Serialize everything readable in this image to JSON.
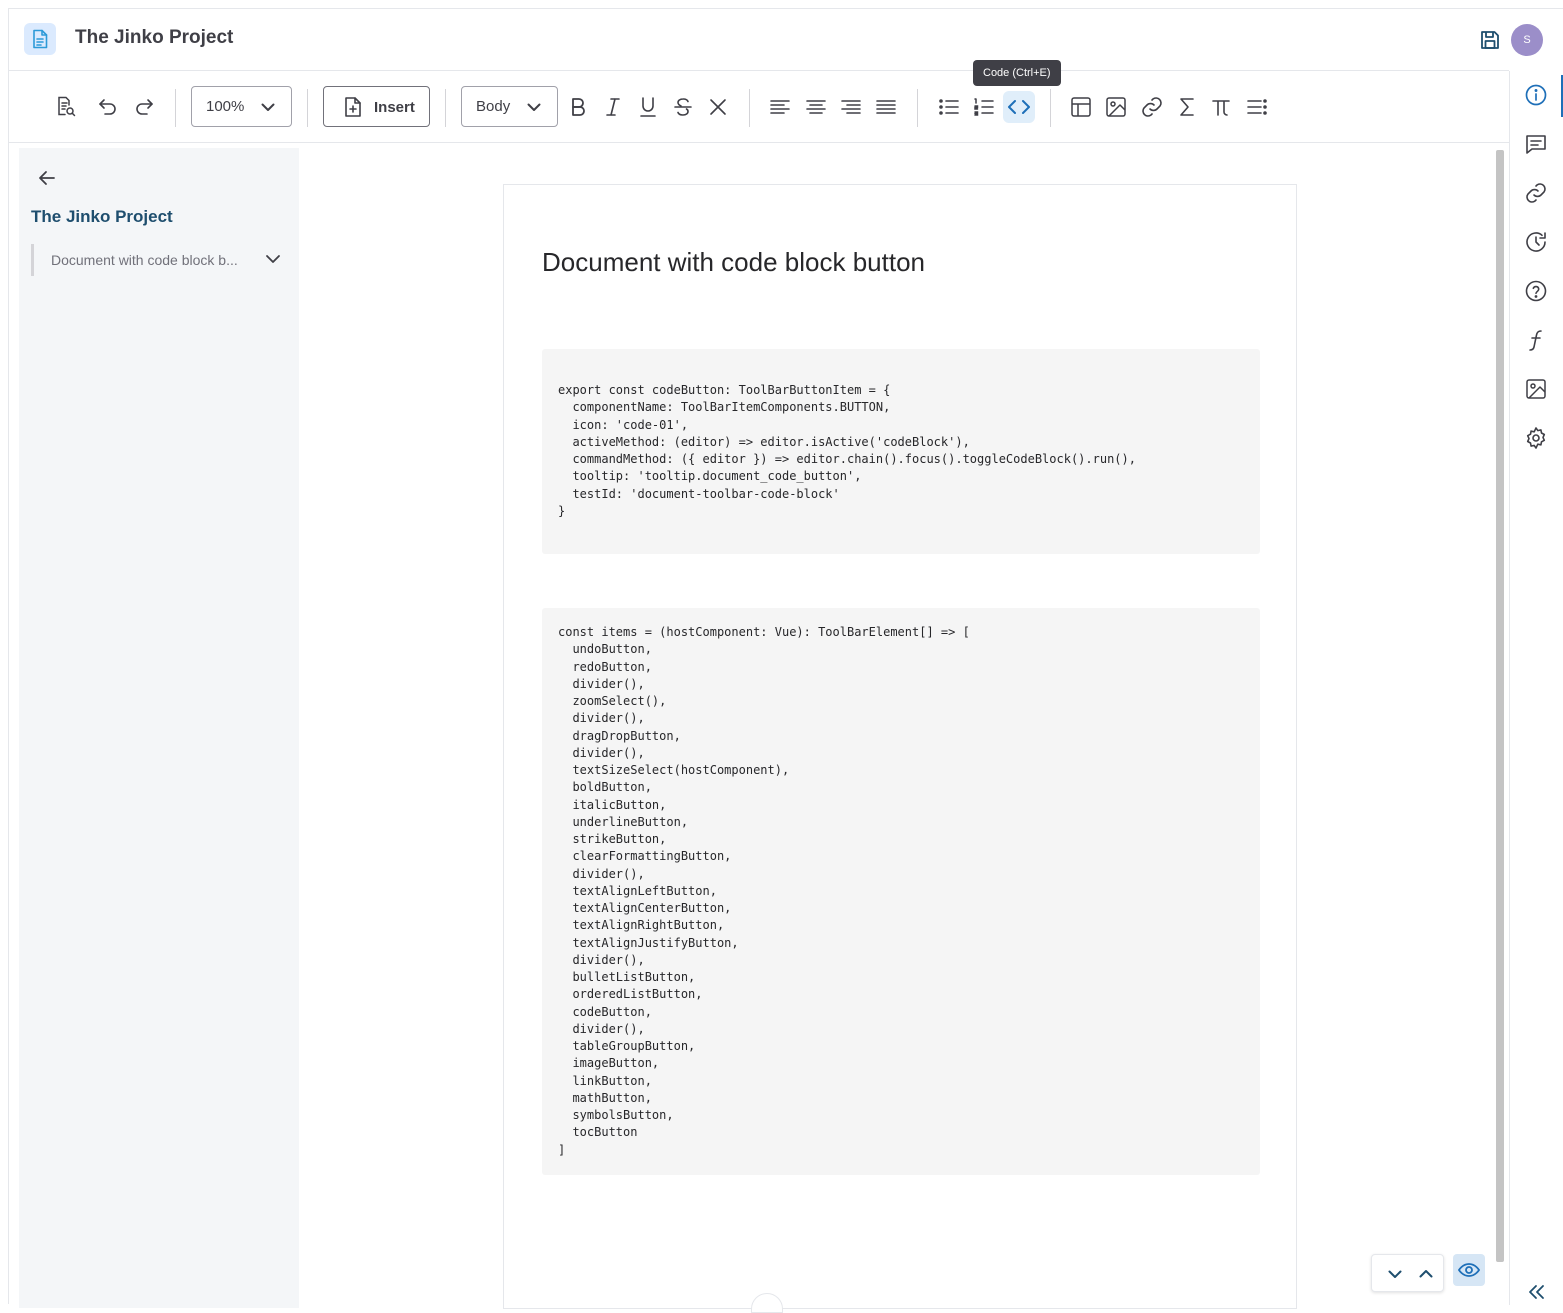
{
  "header": {
    "app_title": "The Jinko Project",
    "avatar_initial": "S"
  },
  "toolbar": {
    "zoom_value": "100%",
    "insert_label": "Insert",
    "text_style_value": "Body",
    "tooltip": "Code (Ctrl+E)",
    "active_button": "code-button"
  },
  "left_panel": {
    "title": "The Jinko Project",
    "doc_item_label": "Document with code block b..."
  },
  "document": {
    "title": "Document with code block button",
    "code_blocks": [
      "export const codeButton: ToolBarButtonItem = {\n  componentName: ToolBarItemComponents.BUTTON,\n  icon: 'code-01',\n  activeMethod: (editor) => editor.isActive('codeBlock'),\n  commandMethod: ({ editor }) => editor.chain().focus().toggleCodeBlock().run(),\n  tooltip: 'tooltip.document_code_button',\n  testId: 'document-toolbar-code-block'\n}",
      "const items = (hostComponent: Vue): ToolBarElement[] => [\n  undoButton,\n  redoButton,\n  divider(),\n  zoomSelect(),\n  divider(),\n  dragDropButton,\n  divider(),\n  textSizeSelect(hostComponent),\n  boldButton,\n  italicButton,\n  underlineButton,\n  strikeButton,\n  clearFormattingButton,\n  divider(),\n  textAlignLeftButton,\n  textAlignCenterButton,\n  textAlignRightButton,\n  textAlignJustifyButton,\n  divider(),\n  bulletListButton,\n  orderedListButton,\n  codeButton,\n  divider(),\n  tableGroupButton,\n  imageButton,\n  linkButton,\n  mathButton,\n  symbolsButton,\n  tocButton\n]"
    ]
  },
  "right_sidebar": {
    "icons": [
      "info-icon",
      "comments-icon",
      "link-icon",
      "history-icon",
      "help-icon",
      "function-icon",
      "image-icon",
      "settings-icon"
    ],
    "active": "info-icon"
  },
  "colors": {
    "accent": "#1e6fb8",
    "panel_title": "#1e4e6e",
    "avatar": "#9b8ec9",
    "code_bg": "#f5f5f5"
  }
}
